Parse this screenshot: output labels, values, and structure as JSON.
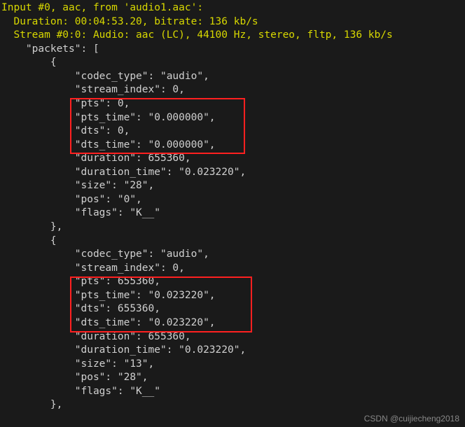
{
  "header": {
    "input_line": "Input #0, aac, from 'audio1.aac':",
    "duration_line": "  Duration: 00:04:53.20, bitrate: 136 kb/s",
    "stream_line": "  Stream #0:0: Audio: aac (LC), 44100 Hz, stereo, fltp, 136 kb/s"
  },
  "packets_open": "    \"packets\": [",
  "packet1": {
    "brace_open": "        {",
    "codec_type": "            \"codec_type\": \"audio\",",
    "stream_index": "            \"stream_index\": 0,",
    "pts": "            \"pts\": 0,",
    "pts_time": "            \"pts_time\": \"0.000000\",",
    "dts": "            \"dts\": 0,",
    "dts_time": "            \"dts_time\": \"0.000000\",",
    "duration": "            \"duration\": 655360,",
    "duration_time": "            \"duration_time\": \"0.023220\",",
    "size": "            \"size\": \"28\",",
    "pos": "            \"pos\": \"0\",",
    "flags": "            \"flags\": \"K__\"",
    "brace_close": "        },"
  },
  "packet2": {
    "brace_open": "        {",
    "codec_type": "            \"codec_type\": \"audio\",",
    "stream_index": "            \"stream_index\": 0,",
    "pts": "            \"pts\": 655360,",
    "pts_time": "            \"pts_time\": \"0.023220\",",
    "dts": "            \"dts\": 655360,",
    "dts_time": "            \"dts_time\": \"0.023220\",",
    "duration": "            \"duration\": 655360,",
    "duration_time": "            \"duration_time\": \"0.023220\",",
    "size": "            \"size\": \"13\",",
    "pos": "            \"pos\": \"28\",",
    "flags": "            \"flags\": \"K__\"",
    "brace_close": "        },"
  },
  "watermark": "CSDN @cuijiecheng2018"
}
